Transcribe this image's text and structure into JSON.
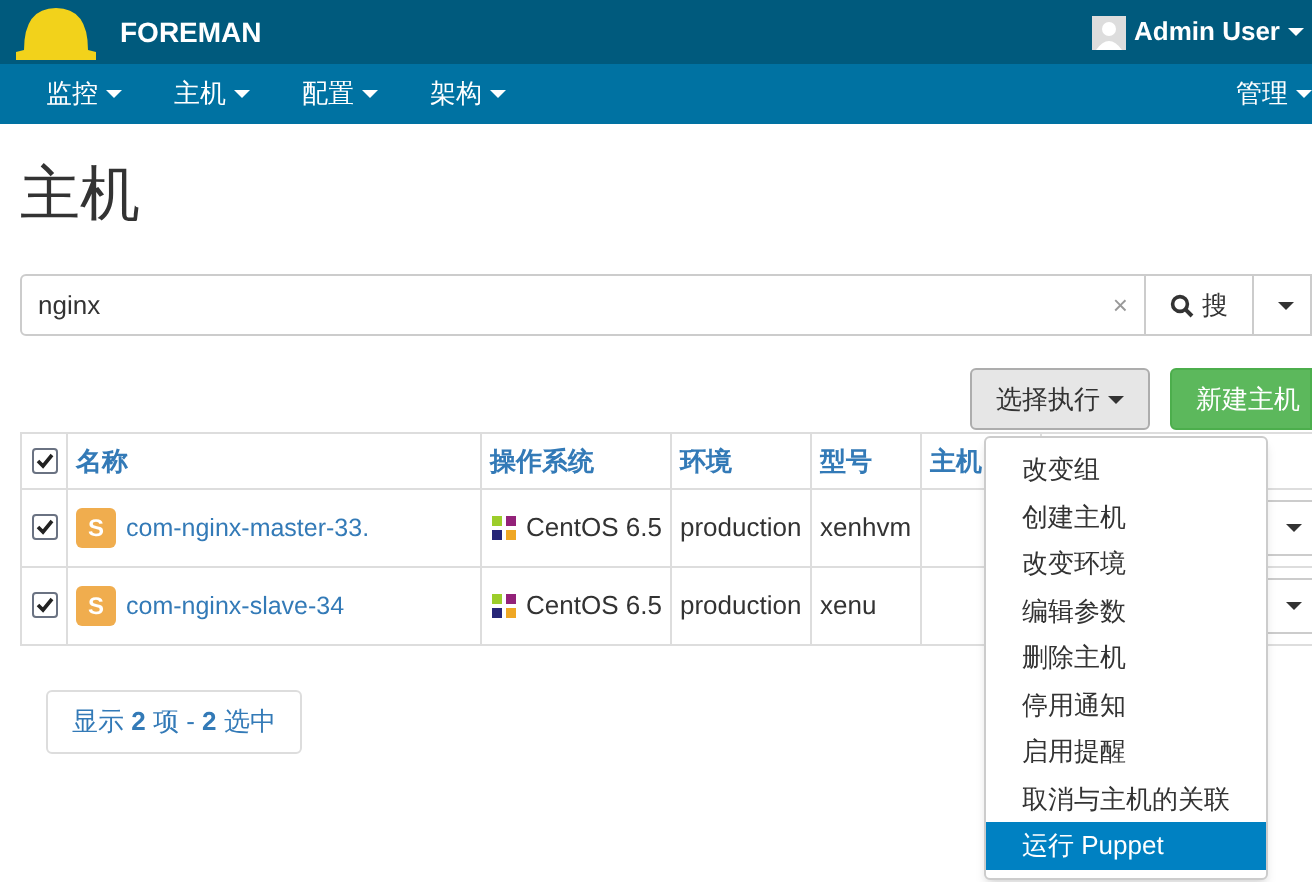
{
  "brand": "FOREMAN",
  "user": "Admin User",
  "nav": [
    "监控",
    "主机",
    "配置",
    "架构"
  ],
  "nav_right": "管理",
  "page_title": "主机",
  "search": {
    "value": "nginx",
    "clear": "×",
    "button": "搜"
  },
  "actions": {
    "select_button": "选择执行",
    "new_button": "新建主机"
  },
  "table": {
    "all_checked": true,
    "columns": [
      "名称",
      "操作系统",
      "环境",
      "型号",
      "主机"
    ],
    "rows": [
      {
        "checked": true,
        "badge": "S",
        "name": "com-nginx-master-33.",
        "os": "CentOS 6.5",
        "environment": "production",
        "model": "xenhvm"
      },
      {
        "checked": true,
        "badge": "S",
        "name": "com-nginx-slave-34",
        "os": "CentOS 6.5",
        "environment": "production",
        "model": "xenu"
      }
    ]
  },
  "menu": [
    {
      "label": "改变组",
      "selected": false
    },
    {
      "label": "创建主机",
      "selected": false
    },
    {
      "label": "改变环境",
      "selected": false
    },
    {
      "label": "编辑参数",
      "selected": false
    },
    {
      "label": "删除主机",
      "selected": false
    },
    {
      "label": "停用通知",
      "selected": false
    },
    {
      "label": "启用提醒",
      "selected": false
    },
    {
      "label": "取消与主机的关联",
      "selected": false
    },
    {
      "label": "运行 Puppet",
      "selected": true
    }
  ],
  "pager": "显示 **2** 项 - **2** 选中"
}
